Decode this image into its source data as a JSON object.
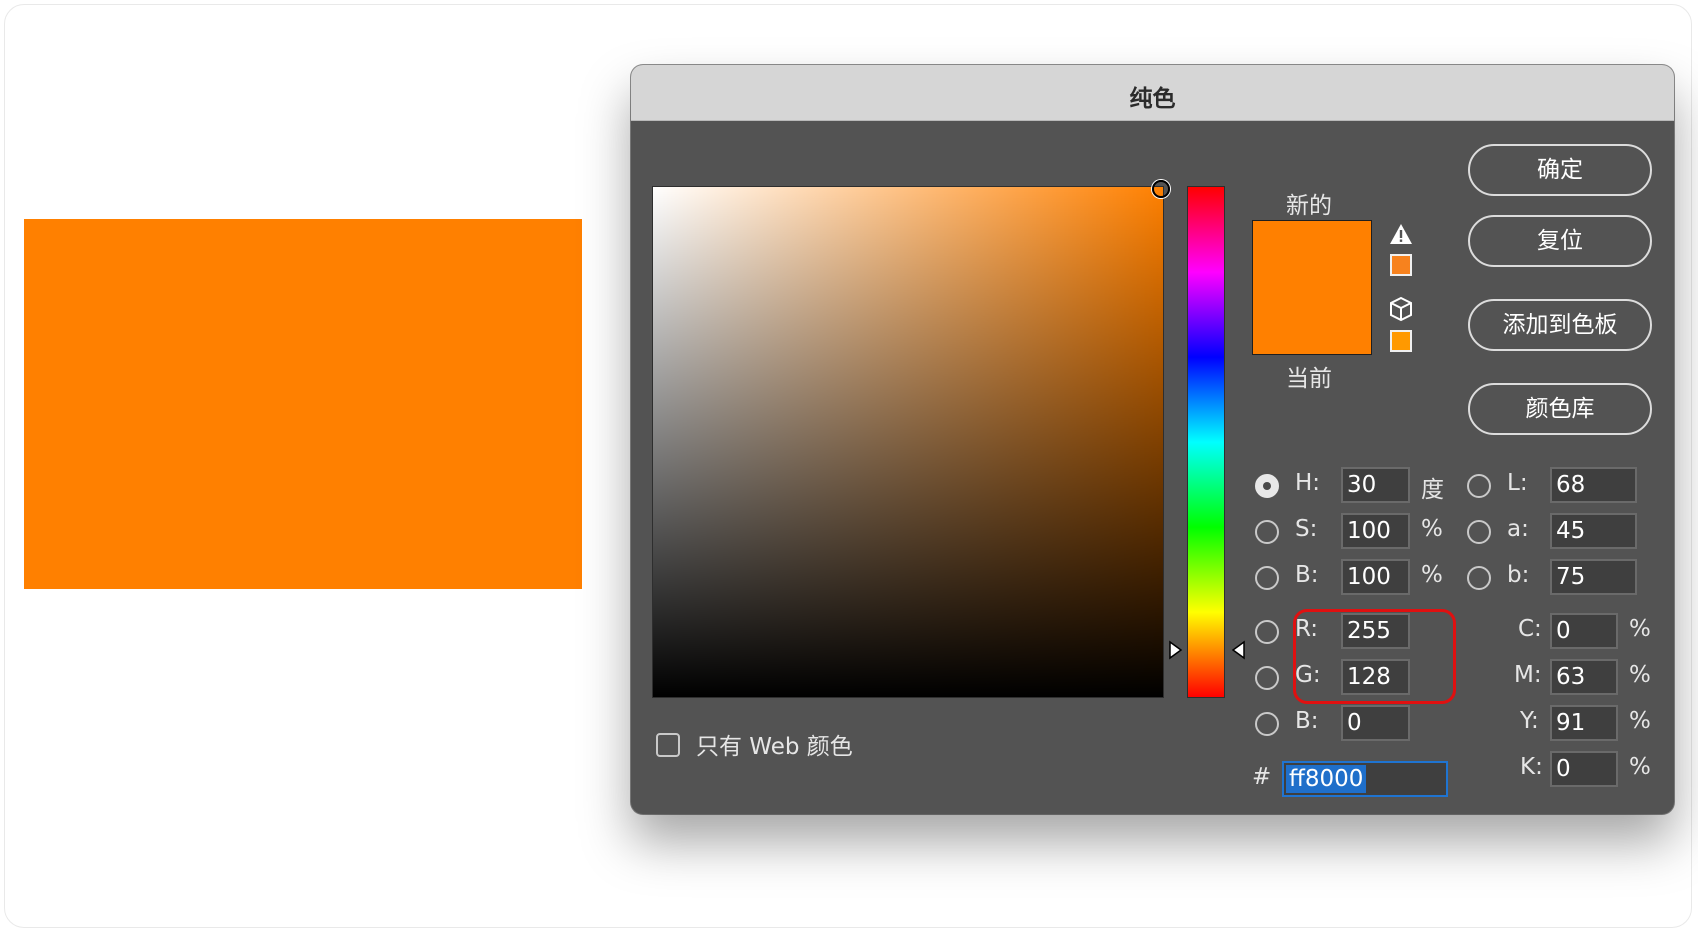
{
  "colors": {
    "preview": "#ff8000",
    "new_color": "#ff8000",
    "current_color": "#ff8000",
    "dialog_bg": "#535353",
    "highlight_border": "#e01010"
  },
  "dialog": {
    "title": "纯色",
    "new_label": "新的",
    "current_label": "当前",
    "gamut_warning_swatch": "#f7821e",
    "web_safe_swatch": "#ff9900",
    "icons": [
      "warning-triangle-icon",
      "cube-icon"
    ]
  },
  "buttons": {
    "ok": "确定",
    "reset": "复位",
    "add_to_swatches": "添加到色板",
    "color_libraries": "颜色库"
  },
  "hsb": {
    "h": {
      "label": "H:",
      "value": "30",
      "unit": "度",
      "selected": true
    },
    "s": {
      "label": "S:",
      "value": "100",
      "unit": "%"
    },
    "b": {
      "label": "B:",
      "value": "100",
      "unit": "%"
    }
  },
  "rgb": {
    "r": {
      "label": "R:",
      "value": "255"
    },
    "g": {
      "label": "G:",
      "value": "128"
    },
    "b": {
      "label": "B:",
      "value": "0"
    }
  },
  "lab": {
    "l": {
      "label": "L:",
      "value": "68"
    },
    "a": {
      "label": "a:",
      "value": "45"
    },
    "b": {
      "label": "b:",
      "value": "75"
    }
  },
  "cmyk": {
    "c": {
      "label": "C:",
      "value": "0",
      "unit": "%"
    },
    "m": {
      "label": "M:",
      "value": "63",
      "unit": "%"
    },
    "y": {
      "label": "Y:",
      "value": "91",
      "unit": "%"
    },
    "k": {
      "label": "K:",
      "value": "0",
      "unit": "%"
    }
  },
  "hex": {
    "prefix": "#",
    "value": "ff8000"
  },
  "web_only": {
    "label": "只有 Web 颜色",
    "checked": false
  }
}
